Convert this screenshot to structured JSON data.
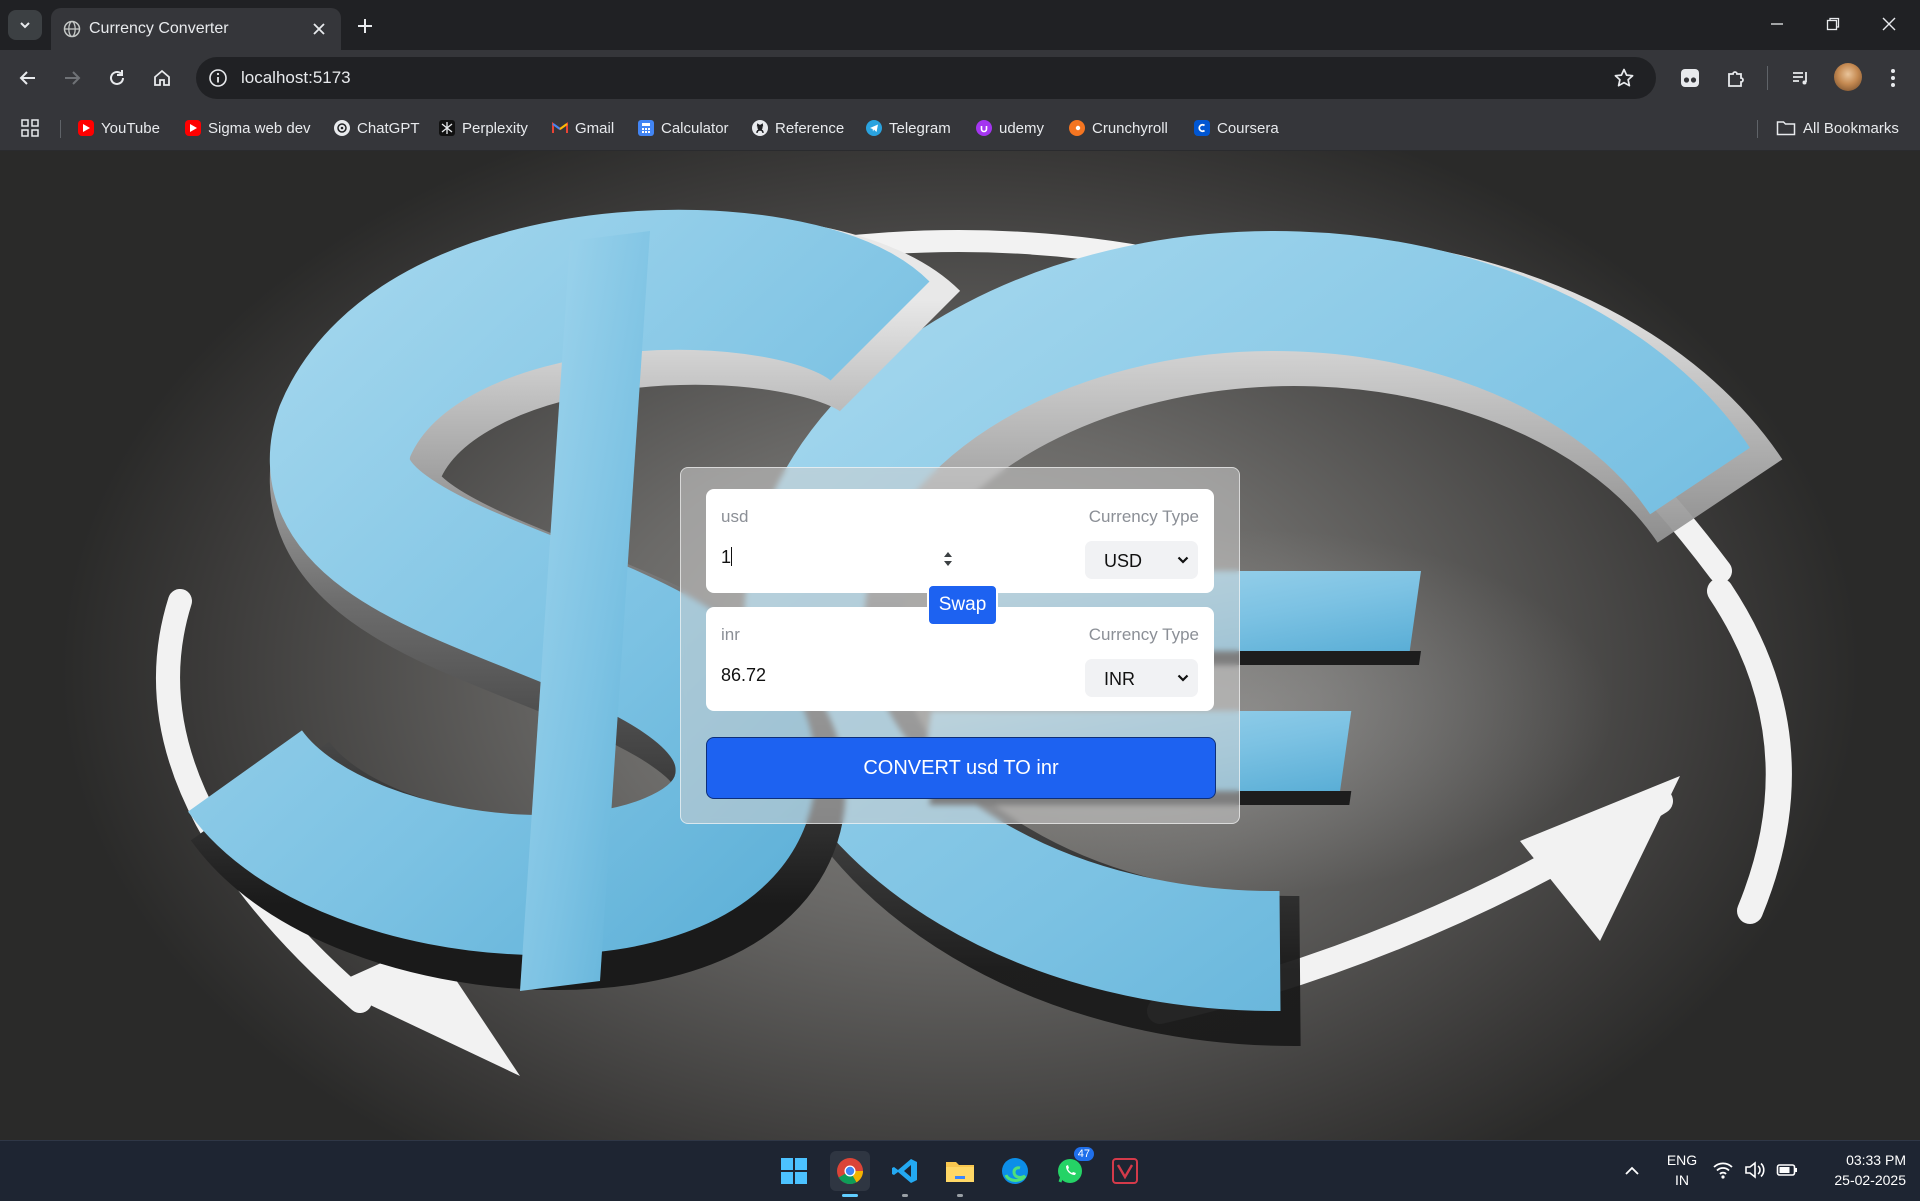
{
  "browser": {
    "tab": {
      "title": "Currency Converter"
    },
    "url": "localhost:5173",
    "bookmarks": [
      {
        "label": "YouTube",
        "icon": "youtube-icon",
        "color": "#ff0000"
      },
      {
        "label": "Sigma web dev",
        "icon": "youtube-icon",
        "color": "#ff0000"
      },
      {
        "label": "ChatGPT",
        "icon": "openai-icon",
        "color": "#ffffff"
      },
      {
        "label": "Perplexity",
        "icon": "perplexity-icon",
        "color": "#20808d"
      },
      {
        "label": "Gmail",
        "icon": "gmail-icon",
        "color": "#ea4335"
      },
      {
        "label": "Calculator",
        "icon": "calculator-icon",
        "color": "#4285f4"
      },
      {
        "label": "Reference",
        "icon": "github-icon",
        "color": "#ffffff"
      },
      {
        "label": "Telegram",
        "icon": "telegram-icon",
        "color": "#2aa3df"
      },
      {
        "label": "udemy",
        "icon": "udemy-icon",
        "color": "#a435f0"
      },
      {
        "label": "Crunchyroll",
        "icon": "crunchyroll-icon",
        "color": "#f47521"
      },
      {
        "label": "Coursera",
        "icon": "coursera-icon",
        "color": "#0056d2"
      }
    ],
    "all_bookmarks": "All Bookmarks"
  },
  "converter": {
    "from": {
      "label": "usd",
      "type_label": "Currency Type",
      "amount": "1",
      "currency": "USD"
    },
    "to": {
      "label": "inr",
      "type_label": "Currency Type",
      "amount": "86.72",
      "currency": "INR"
    },
    "swap_label": "Swap",
    "convert_label": "CONVERT usd TO inr"
  },
  "colors": {
    "accent": "#1d62f1",
    "panel": "#ffffff"
  },
  "taskbar": {
    "apps": [
      "windows-start-icon",
      "chrome-icon",
      "vscode-icon",
      "file-explorer-icon",
      "edge-icon",
      "whatsapp-icon",
      "app-icon"
    ],
    "whatsapp_badge": "47",
    "lang_line1": "ENG",
    "lang_line2": "IN",
    "time": "03:33 PM",
    "date": "25-02-2025"
  }
}
